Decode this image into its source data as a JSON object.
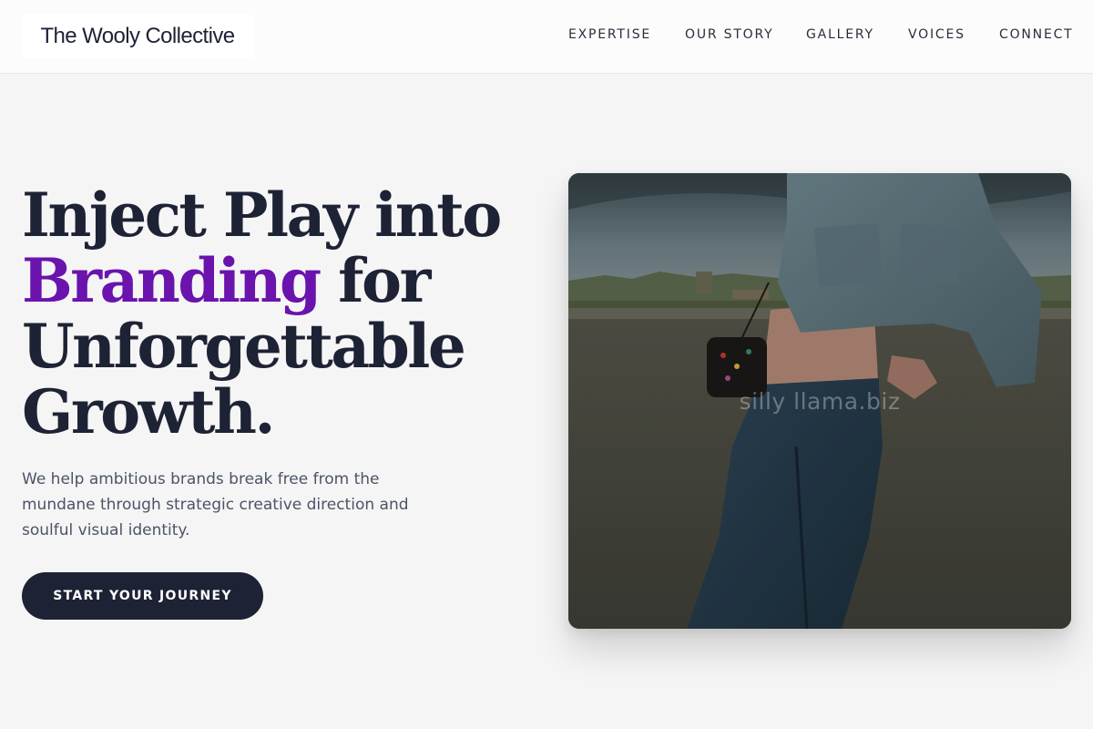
{
  "header": {
    "brand": "The Wooly Collective",
    "nav": [
      "EXPERTISE",
      "OUR STORY",
      "GALLERY",
      "VOICES",
      "CONNECT"
    ]
  },
  "hero": {
    "title_line1": "Inject Play into",
    "title_accent": "Branding",
    "title_line2_rest": " for",
    "title_line3": "Unforgettable",
    "title_line4": "Growth.",
    "subtitle": "We help ambitious brands break free from the mundane through strategic creative direction and soulful visual identity.",
    "cta_label": "START YOUR JOURNEY"
  },
  "image": {
    "watermark": "silly llama.biz"
  },
  "colors": {
    "primary": "#1e2235",
    "accent": "#6a13ad",
    "background": "#f5f5f5"
  }
}
